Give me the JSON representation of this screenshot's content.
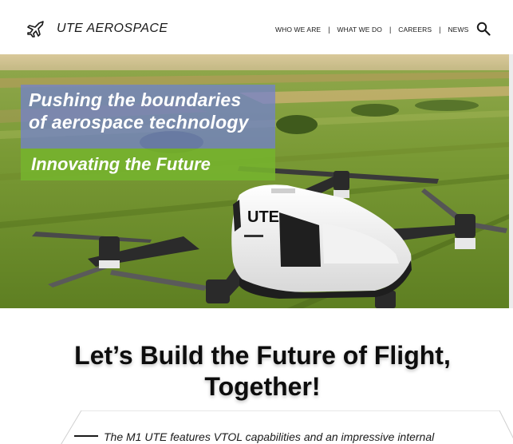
{
  "header": {
    "brand": "UTE AEROSPACE",
    "logo_icon": "airplane-icon",
    "nav": [
      {
        "label": "WHO WE ARE"
      },
      {
        "label": "WHAT WE DO"
      },
      {
        "label": "CAREERS"
      },
      {
        "label": "NEWS"
      }
    ],
    "separator": "|",
    "search_icon": "search-icon"
  },
  "hero": {
    "tagline_line1": "Pushing the boundaries",
    "tagline_line2": "of aerospace technology",
    "tagline_sub": "Innovating the Future",
    "drone_badge": "UTE",
    "colors": {
      "tagline_bg": "#7280d2",
      "sub_bg": "#76b22e"
    }
  },
  "main": {
    "heading_line1": "Let’s Build the Future of Flight,",
    "heading_line2": "Together!",
    "description": "The M1 UTE features VTOL capabilities and an impressive internal"
  }
}
